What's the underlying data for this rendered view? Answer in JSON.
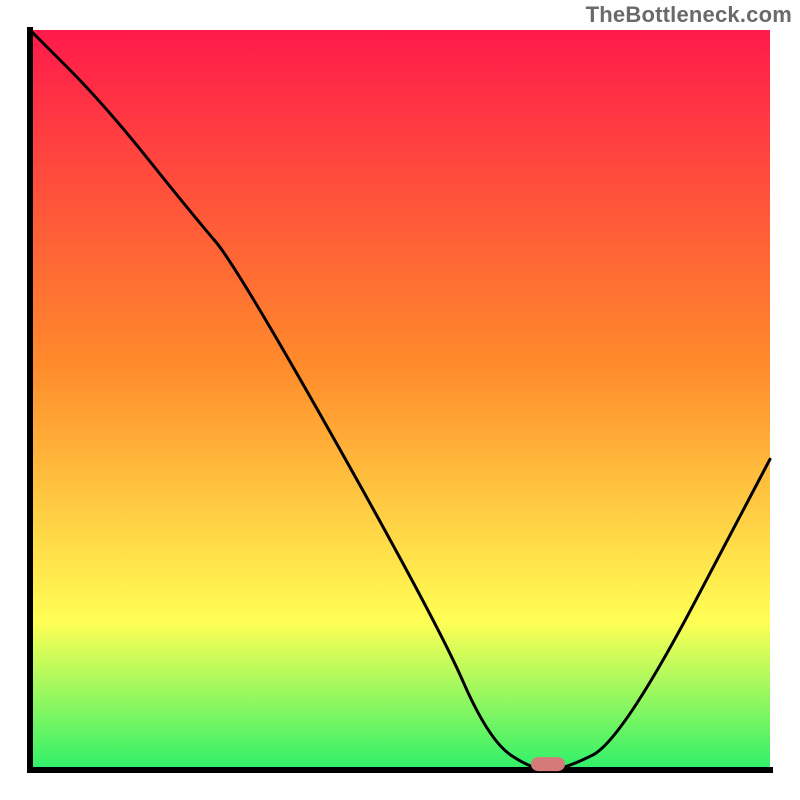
{
  "watermark": "TheBottleneck.com",
  "chart_data": {
    "type": "line",
    "title": "",
    "xlabel": "",
    "ylabel": "",
    "xlim": [
      0,
      100
    ],
    "ylim": [
      0,
      100
    ],
    "grid": false,
    "legend": false,
    "series": [
      {
        "name": "curve",
        "x": [
          0,
          10,
          22,
          28,
          55,
          62,
          68,
          72,
          80,
          100
        ],
        "y": [
          100,
          90,
          75,
          68,
          20,
          4,
          0,
          0,
          4,
          42
        ]
      }
    ],
    "marker": {
      "name": "highlight-mark",
      "x": 70,
      "y": 0.8,
      "color": "#d47b7a"
    },
    "background_gradient": {
      "top": "#ff1a4b",
      "mid1": "#ff8a2b",
      "mid2": "#ffff55",
      "bottom": "#2ef06a"
    },
    "axis_color": "#000000",
    "curve_color": "#000000"
  }
}
